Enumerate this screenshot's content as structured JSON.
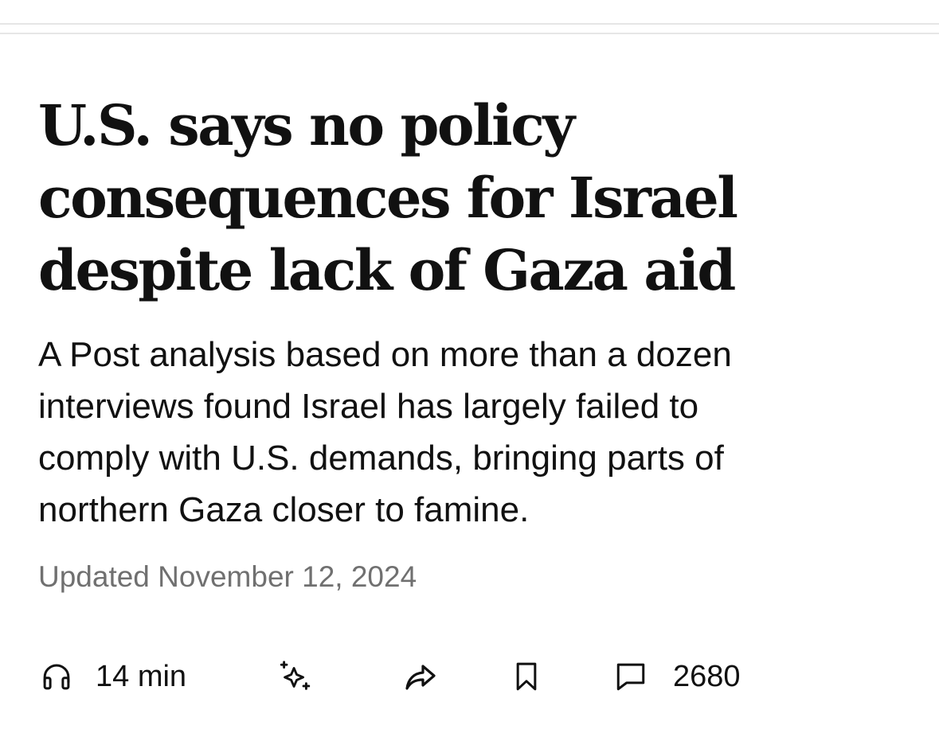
{
  "article": {
    "headline_lines": [
      "U.S. says no policy",
      "consequences for Israel",
      "despite lack of Gaza aid"
    ],
    "dek_lines": [
      "A Post analysis based on more than a dozen",
      "interviews found Israel has largely failed to",
      "comply with U.S. demands, bringing parts of",
      "northern Gaza closer to famine."
    ],
    "updated": "Updated November 12, 2024"
  },
  "actions": {
    "listen": {
      "icon": "headphones-icon",
      "label": "14 min"
    },
    "ai_summary": {
      "icon": "sparkles-icon"
    },
    "share": {
      "icon": "share-arrow-icon"
    },
    "save": {
      "icon": "bookmark-icon"
    },
    "comments": {
      "icon": "comment-icon",
      "count": "2680"
    }
  },
  "colors": {
    "text": "#111111",
    "muted": "#707070",
    "rule": "#e6e6e6",
    "background": "#ffffff"
  }
}
